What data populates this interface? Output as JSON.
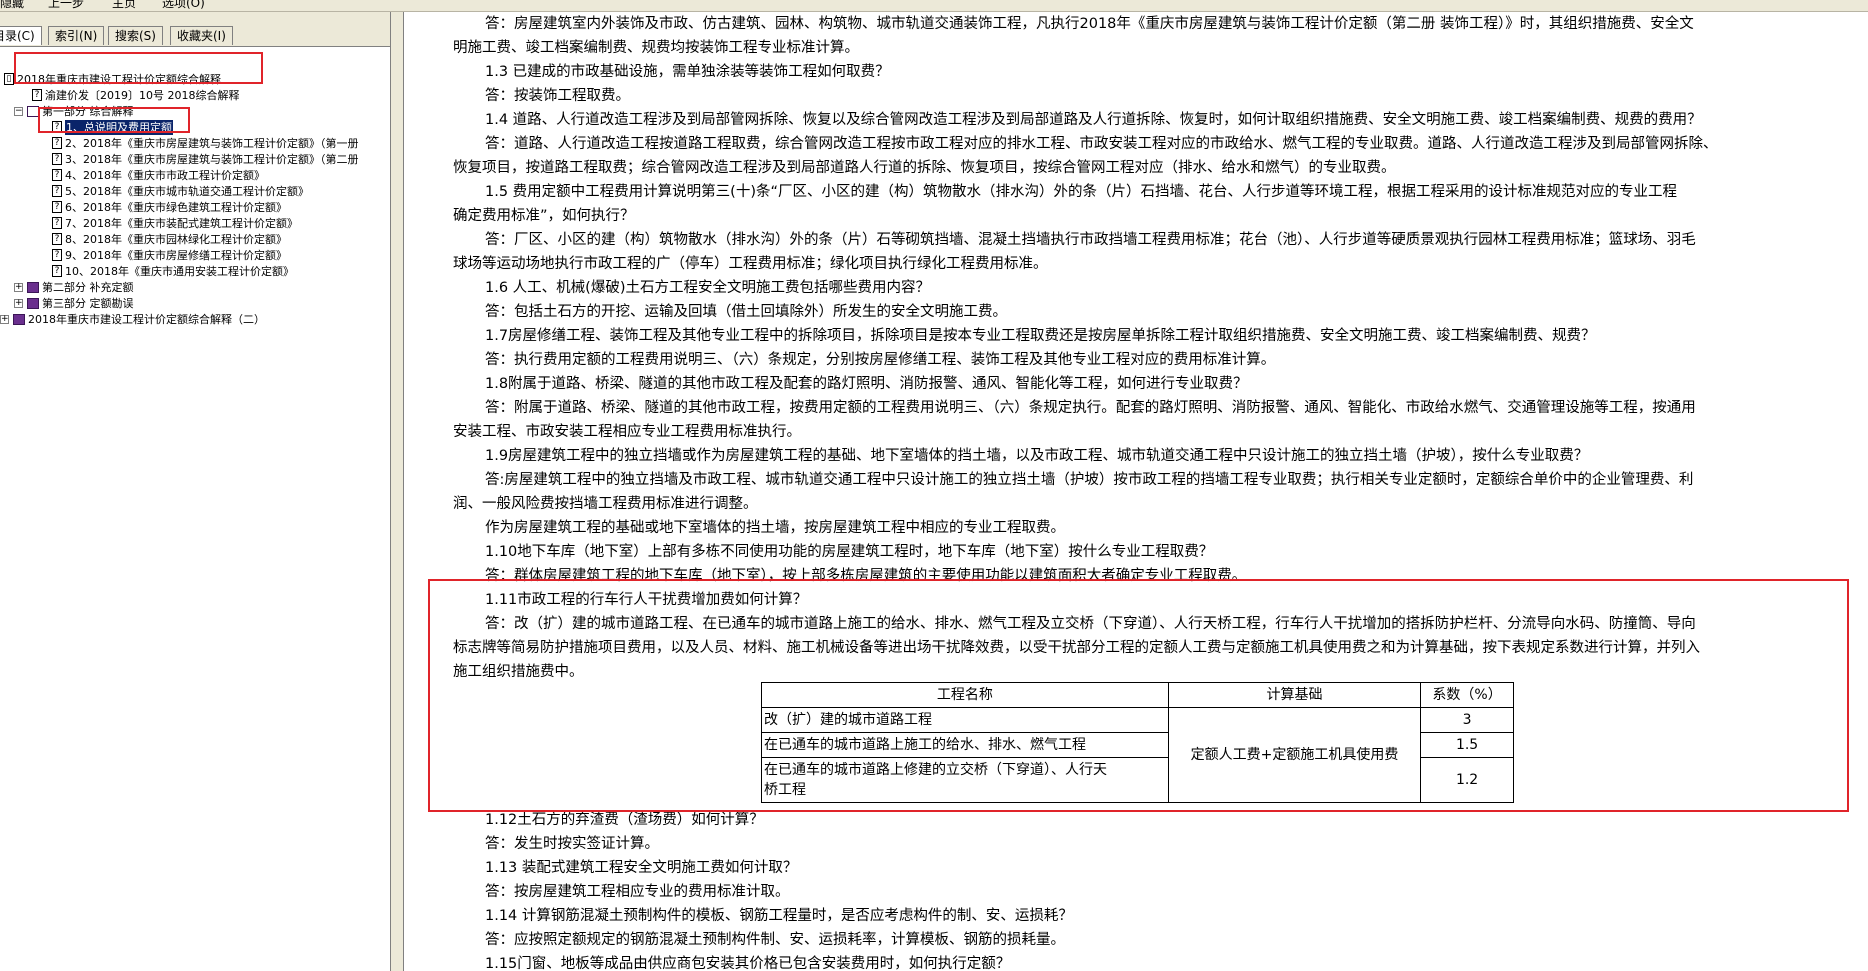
{
  "toolbar": {
    "items": [
      "隐藏",
      "上一步",
      "主页",
      "选项(O)"
    ]
  },
  "tabs": [
    {
      "label": "目录(C)",
      "active": true
    },
    {
      "label": "索引(N)",
      "active": false
    },
    {
      "label": "搜索(S)",
      "active": false
    },
    {
      "label": "收藏夹(I)",
      "active": false
    }
  ],
  "tree": [
    {
      "label": "2018年重庆市建设工程计价定额综合解释",
      "icon": "doc",
      "expander": "−"
    },
    {
      "label": "渝建价发〔2019〕10号 2018综合解释",
      "icon": "doc"
    },
    {
      "label": "第一部分 综合解释",
      "icon": "openbook",
      "expander": "−"
    },
    {
      "label": "1、总说明及费用定额",
      "icon": "doc",
      "selected": true
    },
    {
      "label": "2、2018年《重庆市房屋建筑与装饰工程计价定额》（第一册",
      "icon": "doc"
    },
    {
      "label": "3、2018年《重庆市房屋建筑与装饰工程计价定额》（第二册",
      "icon": "doc"
    },
    {
      "label": "4、2018年《重庆市市政工程计价定额》",
      "icon": "doc"
    },
    {
      "label": "5、2018年《重庆市城市轨道交通工程计价定额》",
      "icon": "doc"
    },
    {
      "label": "6、2018年《重庆市绿色建筑工程计价定额》",
      "icon": "doc"
    },
    {
      "label": "7、2018年《重庆市装配式建筑工程计价定额》",
      "icon": "doc"
    },
    {
      "label": "8、2018年《重庆市园林绿化工程计价定额》",
      "icon": "doc"
    },
    {
      "label": "9、2018年《重庆市房屋修缮工程计价定额》",
      "icon": "doc"
    },
    {
      "label": "10、2018年《重庆市通用安装工程计价定额》",
      "icon": "doc"
    },
    {
      "label": "第二部分 补充定额",
      "icon": "book",
      "expander": "+"
    },
    {
      "label": "第三部分 定额勘误",
      "icon": "book",
      "expander": "+"
    },
    {
      "label": "2018年重庆市建设工程计价定额综合解释（二）",
      "icon": "book",
      "expander": "+"
    }
  ],
  "content": {
    "lines": [
      "答：房屋建筑室内外装饰及市政、仿古建筑、园林、构筑物、城市轨道交通装饰工程，凡执行2018年《重庆市房屋建筑与装饰工程计价定额（第二册 装饰工程）》时，其组织措施费、安全文",
      "明施工费、竣工档案编制费、规费均按装饰工程专业标准计算。",
      "1.3 已建成的市政基础设施，需单独涂装等装饰工程如何取费？",
      "答：按装饰工程取费。",
      "1.4 道路、人行道改造工程涉及到局部管网拆除、恢复以及综合管网改造工程涉及到局部道路及人行道拆除、恢复时，如何计取组织措施费、安全文明施工费、竣工档案编制费、规费的费用？",
      "答：道路、人行道改造工程按道路工程取费，综合管网改造工程按市政工程对应的排水工程、市政安装工程对应的市政给水、燃气工程的专业取费。道路、人行道改造工程涉及到局部管网拆除、",
      "恢复项目，按道路工程取费；综合管网改造工程涉及到局部道路人行道的拆除、恢复项目，按综合管网工程对应（排水、给水和燃气）的专业取费。",
      "1.5 费用定额中工程费用计算说明第三(十)条“厂区、小区的建（构）筑物散水（排水沟）外的条（片）石挡墙、花台、人行步道等环境工程，根据工程采用的设计标准规范对应的专业工程",
      "确定费用标准”，如何执行？",
      "答：厂区、小区的建（构）筑物散水（排水沟）外的条（片）石等砌筑挡墙、混凝土挡墙执行市政挡墙工程费用标准；花台（池）、人行步道等硬质景观执行园林工程费用标准；篮球场、羽毛",
      "球场等运动场地执行市政工程的广（停车）工程费用标准；绿化项目执行绿化工程费用标准。",
      "1.6 人工、机械(爆破)土石方工程安全文明施工费包括哪些费用内容？",
      "答：包括土石方的开挖、运输及回填（借土回填除外）所发生的安全文明施工费。",
      "1.7房屋修缮工程、装饰工程及其他专业工程中的拆除项目，拆除项目是按本专业工程取费还是按房屋单拆除工程计取组织措施费、安全文明施工费、竣工档案编制费、规费？",
      "答：执行费用定额的工程费用说明三、（六）条规定，分别按房屋修缮工程、装饰工程及其他专业工程对应的费用标准计算。",
      "1.8附属于道路、桥梁、隧道的其他市政工程及配套的路灯照明、消防报警、通风、智能化等工程，如何进行专业取费？",
      "答：附属于道路、桥梁、隧道的其他市政工程，按费用定额的工程费用说明三、（六）条规定执行。配套的路灯照明、消防报警、通风、智能化、市政给水燃气、交通管理设施等工程，按通用",
      "安装工程、市政安装工程相应专业工程费用标准执行。",
      "1.9房屋建筑工程中的独立挡墙或作为房屋建筑工程的基础、地下室墙体的挡土墙，以及市政工程、城市轨道交通工程中只设计施工的独立挡土墙（护坡），按什么专业取费？",
      "答:房屋建筑工程中的独立挡墙及市政工程、城市轨道交通工程中只设计施工的独立挡土墙（护坡）按市政工程的挡墙工程专业取费；执行相关专业定额时，定额综合单价中的企业管理费、利",
      "润、一般风险费按挡墙工程费用标准进行调整。",
      "作为房屋建筑工程的基础或地下室墙体的挡土墙，按房屋建筑工程中相应的专业工程取费。",
      "1.10地下车库（地下室）上部有多栋不同使用功能的房屋建筑工程时，地下车库（地下室）按什么专业工程取费？",
      "答：群体房屋建筑工程的地下车库（地下室），按上部多栋房屋建筑的主要使用功能以建筑面积大者确定专业工程取费。",
      "1.11市政工程的行车行人干扰费增加费如何计算？",
      "答：改（扩）建的城市道路工程、在已通车的城市道路上施工的给水、排水、燃气工程及立交桥（下穿道）、人行天桥工程，行车行人干扰增加的搭拆防护栏杆、分流导向水码、防撞筒、导向",
      "标志牌等简易防护措施项目费用，以及人员、材料、施工机械设备等进出场干扰降效费，以受干扰部分工程的定额人工费与定额施工机具使用费之和为计算基础，按下表规定系数进行计算，并列入",
      "施工组织措施费中。"
    ],
    "table": {
      "headers": [
        "工程名称",
        "计算基础",
        "系数（%）"
      ],
      "rows": [
        {
          "name": "改（扩）建的城市道路工程",
          "coef": "3"
        },
        {
          "name": "在已通车的城市道路上施工的给水、排水、燃气工程",
          "coef": "1.5"
        },
        {
          "name_line1": "在已通车的城市道路上修建的立交桥（下穿道）、人行天",
          "name_line2": "桥工程",
          "coef": "1.2"
        }
      ],
      "base": "定额人工费+定额施工机具使用费"
    },
    "after": [
      "1.12土石方的弃渣费（渣场费）如何计算？",
      "答：发生时按实签证计算。",
      "1.13 装配式建筑工程安全文明施工费如何计取？",
      "答：按房屋建筑工程相应专业的费用标准计取。",
      "1.14 计算钢筋混凝土预制构件的模板、钢筋工程量时，是否应考虑构件的制、安、运损耗？",
      "答：应按照定额规定的钢筋混凝土预制构件制、安、运损耗率，计算模板、钢筋的损耗量。",
      "1.15门窗、地板等成品由供应商包安装其价格已包含安装费用时，如何执行定额？"
    ]
  }
}
